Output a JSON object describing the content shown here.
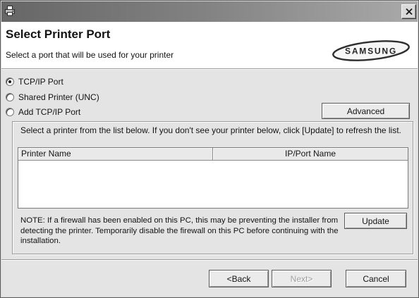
{
  "titlebar": {
    "app_icon": "printer-setup-icon",
    "close_icon": "close-icon"
  },
  "header": {
    "title": "Select Printer Port",
    "subtitle": "Select a port that will be used for your printer",
    "logo_text": "SAMSUNG"
  },
  "port_options": [
    {
      "label": "TCP/IP Port",
      "selected": true
    },
    {
      "label": "Shared Printer (UNC)",
      "selected": false
    },
    {
      "label": "Add TCP/IP Port",
      "selected": false
    }
  ],
  "advanced_button": {
    "label": "Advanced"
  },
  "printer_list": {
    "instruction": "Select a printer from the list below. If you don't see your printer below, click [Update] to refresh the list.",
    "columns": [
      "Printer Name",
      "IP/Port Name"
    ],
    "rows": []
  },
  "note": "NOTE: If a firewall has been enabled on this PC, this may be preventing the installer from detecting the printer. Temporarily disable the firewall on this PC before continuing with the installation.",
  "update_button": {
    "label": "Update"
  },
  "footer": {
    "back": {
      "label": "<Back",
      "enabled": true
    },
    "next": {
      "label": "Next>",
      "enabled": false
    },
    "cancel": {
      "label": "Cancel",
      "enabled": true
    }
  }
}
